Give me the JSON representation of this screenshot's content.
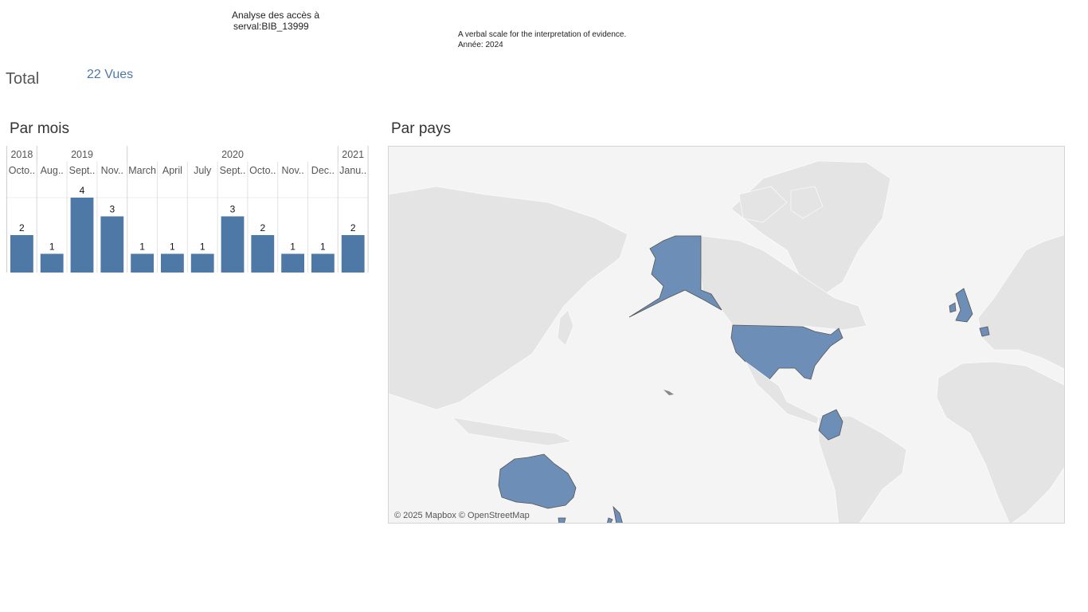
{
  "header": {
    "title_line1": "Analyse des accès à",
    "title_line2": "serval:BIB_13999",
    "subtitle_line1": "A verbal scale for the interpretation of evidence.",
    "subtitle_line2": "Année: 2024"
  },
  "total": {
    "label": "Total",
    "value": "22 Vues"
  },
  "sections": {
    "by_month": "Par mois",
    "by_country": "Par pays"
  },
  "map": {
    "credit": "© 2025 Mapbox © OpenStreetMap",
    "highlighted_countries": [
      "United States",
      "Australia",
      "United Kingdom",
      "Colombia",
      "New Zealand",
      "Belgium",
      "Netherlands"
    ]
  },
  "colors": {
    "bar": "#4e79a7",
    "map_highlight": "#6d8fb7",
    "land": "#e3e3e3",
    "grid": "#d4d4d4",
    "header_text": "#555555"
  },
  "chart_data": {
    "type": "bar",
    "title": "Par mois",
    "year_groups": [
      {
        "year": "2018",
        "span": 1
      },
      {
        "year": "2019",
        "span": 3
      },
      {
        "year": "2020",
        "span": 7
      },
      {
        "year": "2021",
        "span": 1
      }
    ],
    "categories": [
      "Octo..",
      "Aug..",
      "Sept..",
      "Nov..",
      "March",
      "April",
      "July",
      "Sept..",
      "Octo..",
      "Nov..",
      "Dec..",
      "Janu.."
    ],
    "values": [
      2,
      1,
      4,
      3,
      1,
      1,
      1,
      3,
      2,
      1,
      1,
      2
    ],
    "ylim": [
      0,
      4
    ],
    "grid": false
  }
}
